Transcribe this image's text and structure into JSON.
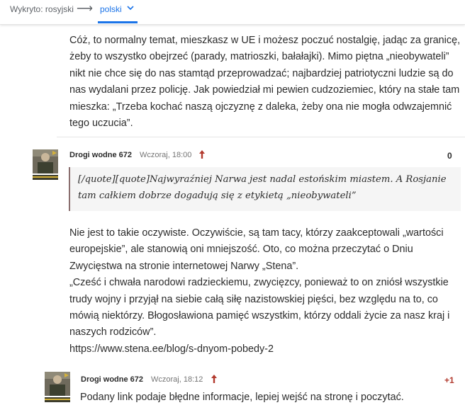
{
  "translate_bar": {
    "detected_label": "Wykryto: rosyjski",
    "target_language": "polski",
    "arrow_icon": "right-arrow-icon",
    "dropdown_icon": "chevron-down-icon",
    "accent_color": "#1a73e8"
  },
  "intro_paragraph": [
    "Cóż, to normalny temat, mieszkasz w UE i możesz poczuć nostalgię, jadąc za granicę,",
    "żeby to wszystko obejrzeć (parady, matrioszki, bałałajki). Mimo piętna „nieobywateli”",
    "nikt nie chce się do nas stamtąd przeprowadzać; najbardziej patriotyczni ludzie są do",
    "nas wydalani przez policję. Jak powiedział mi pewien cudzoziemiec, który na stałe tam",
    "mieszka: „Trzeba kochać naszą ojczyznę z daleka, żeby ona nie mogła odwzajemnić",
    "tego uczucia”."
  ],
  "comments": [
    {
      "author": "Drogi wodne 672",
      "date": "Wczoraj, 18:00",
      "score": "0",
      "quote_lines": [
        "[/quote][quote]Najwyraźniej Narwa jest nadal estońskim miastem. A Rosjanie",
        "tam całkiem dobrze dogadują się z etykietą „nieobywateli”"
      ],
      "body_lines": [
        "Nie jest to takie oczywiste. Oczywiście, są tam tacy, którzy zaakceptowali „wartości",
        "europejskie”, ale stanowią oni mniejszość. Oto, co można przeczytać o Dniu",
        "Zwycięstwa na stronie internetowej Narwy „Stena”.",
        "„Cześć i chwała narodowi radzieckiemu, zwycięzcy, ponieważ to on zniósł wszystkie",
        "trudy wojny i przyjął na siebie całą siłę nazistowskiej pięści, bez względu na to, co",
        "mówią niektórzy. Błogosławiona pamięć wszystkim, którzy oddali życie za nasz kraj i",
        "naszych rodziców”.",
        "https://www.stena.ee/blog/s-dnyom-pobedy-2"
      ],
      "vote_icon": "upvote-arrow-icon",
      "vote_color": "#b23a2e"
    },
    {
      "author": "Drogi wodne 672",
      "date": "Wczoraj, 18:12",
      "score": "+1",
      "score_color": "#b23a2e",
      "body_lines": [
        "Podany link podaje błędne informacje, lepiej wejść na stronę i poczytać."
      ],
      "vote_icon": "upvote-arrow-icon",
      "vote_color": "#b23a2e"
    }
  ]
}
